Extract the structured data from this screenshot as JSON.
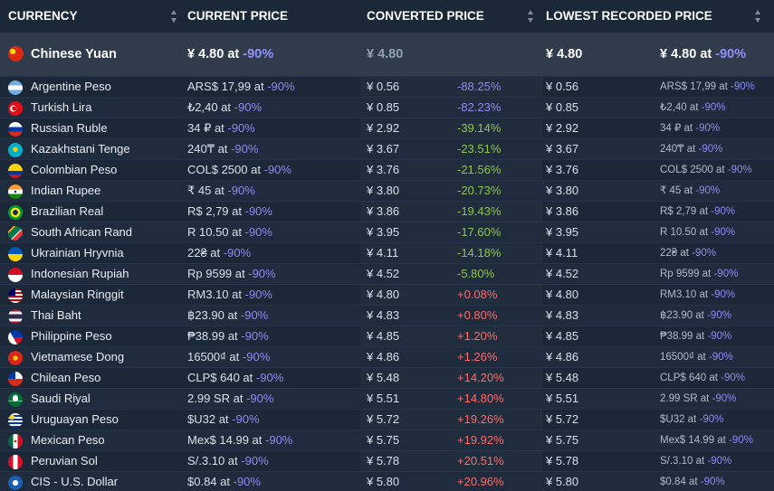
{
  "header": {
    "currency": "CURRENCY",
    "current_price": "CURRENT PRICE",
    "converted_price": "CONVERTED PRICE",
    "lowest_recorded_price": "LOWEST RECORDED PRICE"
  },
  "base": {
    "name": "Chinese Yuan",
    "flag": "cn",
    "price": "¥ 4.80 at",
    "discount": "-90%",
    "converted": "¥ 4.80",
    "lowest": "¥ 4.80",
    "lowest_detail": "¥ 4.80 at",
    "lowest_discount": "-90%"
  },
  "rows": [
    {
      "name": "Argentine Peso",
      "flag": "ar",
      "price": "ARS$ 17,99 at",
      "discount": "-90%",
      "converted": "¥ 0.56",
      "diff": "-88.25%",
      "diff_color": "neg",
      "lowest": "¥ 0.56",
      "lowest_detail": "ARS$ 17,99 at",
      "lowest_discount": "-90%"
    },
    {
      "name": "Turkish Lira",
      "flag": "tr",
      "price": "₺2,40 at",
      "discount": "-90%",
      "converted": "¥ 0.85",
      "diff": "-82.23%",
      "diff_color": "neg",
      "lowest": "¥ 0.85",
      "lowest_detail": "₺2,40 at",
      "lowest_discount": "-90%"
    },
    {
      "name": "Russian Ruble",
      "flag": "ru",
      "price": "34 ₽ at",
      "discount": "-90%",
      "converted": "¥ 2.92",
      "diff": "-39.14%",
      "diff_color": "grn",
      "lowest": "¥ 2.92",
      "lowest_detail": "34 ₽ at",
      "lowest_discount": "-90%"
    },
    {
      "name": "Kazakhstani Tenge",
      "flag": "kz",
      "price": "240₸ at",
      "discount": "-90%",
      "converted": "¥ 3.67",
      "diff": "-23.51%",
      "diff_color": "grn",
      "lowest": "¥ 3.67",
      "lowest_detail": "240₸ at",
      "lowest_discount": "-90%"
    },
    {
      "name": "Colombian Peso",
      "flag": "co",
      "price": "COL$ 2500 at",
      "discount": "-90%",
      "converted": "¥ 3.76",
      "diff": "-21.56%",
      "diff_color": "grn",
      "lowest": "¥ 3.76",
      "lowest_detail": "COL$ 2500 at",
      "lowest_discount": "-90%"
    },
    {
      "name": "Indian Rupee",
      "flag": "in",
      "price": "₹ 45 at",
      "discount": "-90%",
      "converted": "¥ 3.80",
      "diff": "-20.73%",
      "diff_color": "grn",
      "lowest": "¥ 3.80",
      "lowest_detail": "₹ 45 at",
      "lowest_discount": "-90%"
    },
    {
      "name": "Brazilian Real",
      "flag": "br",
      "price": "R$ 2,79 at",
      "discount": "-90%",
      "converted": "¥ 3.86",
      "diff": "-19.43%",
      "diff_color": "grn",
      "lowest": "¥ 3.86",
      "lowest_detail": "R$ 2,79 at",
      "lowest_discount": "-90%"
    },
    {
      "name": "South African Rand",
      "flag": "za",
      "price": "R 10.50 at",
      "discount": "-90%",
      "converted": "¥ 3.95",
      "diff": "-17.60%",
      "diff_color": "grn",
      "lowest": "¥ 3.95",
      "lowest_detail": "R 10.50 at",
      "lowest_discount": "-90%"
    },
    {
      "name": "Ukrainian Hryvnia",
      "flag": "ua",
      "price": "22₴ at",
      "discount": "-90%",
      "converted": "¥ 4.11",
      "diff": "-14.18%",
      "diff_color": "grn",
      "lowest": "¥ 4.11",
      "lowest_detail": "22₴ at",
      "lowest_discount": "-90%"
    },
    {
      "name": "Indonesian Rupiah",
      "flag": "id",
      "price": "Rp 9599 at",
      "discount": "-90%",
      "converted": "¥ 4.52",
      "diff": "-5.80%",
      "diff_color": "grn",
      "lowest": "¥ 4.52",
      "lowest_detail": "Rp 9599 at",
      "lowest_discount": "-90%"
    },
    {
      "name": "Malaysian Ringgit",
      "flag": "my",
      "price": "RM3.10 at",
      "discount": "-90%",
      "converted": "¥ 4.80",
      "diff": "+0.08%",
      "diff_color": "red",
      "lowest": "¥ 4.80",
      "lowest_detail": "RM3.10 at",
      "lowest_discount": "-90%"
    },
    {
      "name": "Thai Baht",
      "flag": "th",
      "price": "฿23.90 at",
      "discount": "-90%",
      "converted": "¥ 4.83",
      "diff": "+0.80%",
      "diff_color": "red",
      "lowest": "¥ 4.83",
      "lowest_detail": "฿23.90 at",
      "lowest_discount": "-90%"
    },
    {
      "name": "Philippine Peso",
      "flag": "ph",
      "price": "₱38.99 at",
      "discount": "-90%",
      "converted": "¥ 4.85",
      "diff": "+1.20%",
      "diff_color": "red",
      "lowest": "¥ 4.85",
      "lowest_detail": "₱38.99 at",
      "lowest_discount": "-90%"
    },
    {
      "name": "Vietnamese Dong",
      "flag": "vn",
      "price": "16500₫ at",
      "discount": "-90%",
      "converted": "¥ 4.86",
      "diff": "+1.26%",
      "diff_color": "red",
      "lowest": "¥ 4.86",
      "lowest_detail": "16500₫ at",
      "lowest_discount": "-90%"
    },
    {
      "name": "Chilean Peso",
      "flag": "cl",
      "price": "CLP$ 640 at",
      "discount": "-90%",
      "converted": "¥ 5.48",
      "diff": "+14.20%",
      "diff_color": "red",
      "lowest": "¥ 5.48",
      "lowest_detail": "CLP$ 640 at",
      "lowest_discount": "-90%"
    },
    {
      "name": "Saudi Riyal",
      "flag": "sa",
      "price": "2.99 SR at",
      "discount": "-90%",
      "converted": "¥ 5.51",
      "diff": "+14.80%",
      "diff_color": "red",
      "lowest": "¥ 5.51",
      "lowest_detail": "2.99 SR at",
      "lowest_discount": "-90%"
    },
    {
      "name": "Uruguayan Peso",
      "flag": "uy",
      "price": "$U32 at",
      "discount": "-90%",
      "converted": "¥ 5.72",
      "diff": "+19.26%",
      "diff_color": "red",
      "lowest": "¥ 5.72",
      "lowest_detail": "$U32 at",
      "lowest_discount": "-90%"
    },
    {
      "name": "Mexican Peso",
      "flag": "mx",
      "price": "Mex$ 14.99 at",
      "discount": "-90%",
      "converted": "¥ 5.75",
      "diff": "+19.92%",
      "diff_color": "red",
      "lowest": "¥ 5.75",
      "lowest_detail": "Mex$ 14.99 at",
      "lowest_discount": "-90%"
    },
    {
      "name": "Peruvian Sol",
      "flag": "pe",
      "price": "S/.3.10 at",
      "discount": "-90%",
      "converted": "¥ 5.78",
      "diff": "+20.51%",
      "diff_color": "red",
      "lowest": "¥ 5.78",
      "lowest_detail": "S/.3.10 at",
      "lowest_discount": "-90%"
    },
    {
      "name": "CIS - U.S. Dollar",
      "flag": "cis",
      "price": "$0.84 at",
      "discount": "-90%",
      "converted": "¥ 5.80",
      "diff": "+20.96%",
      "diff_color": "red",
      "lowest": "¥ 5.80",
      "lowest_detail": "$0.84 at",
      "lowest_discount": "-90%"
    }
  ],
  "colors": {
    "background": "#1b2838",
    "highlight_row": "#303c4b",
    "discount": "#8c8df0",
    "positive_diff": "#ff6b6b",
    "negative_diff_green": "#90c54b"
  }
}
